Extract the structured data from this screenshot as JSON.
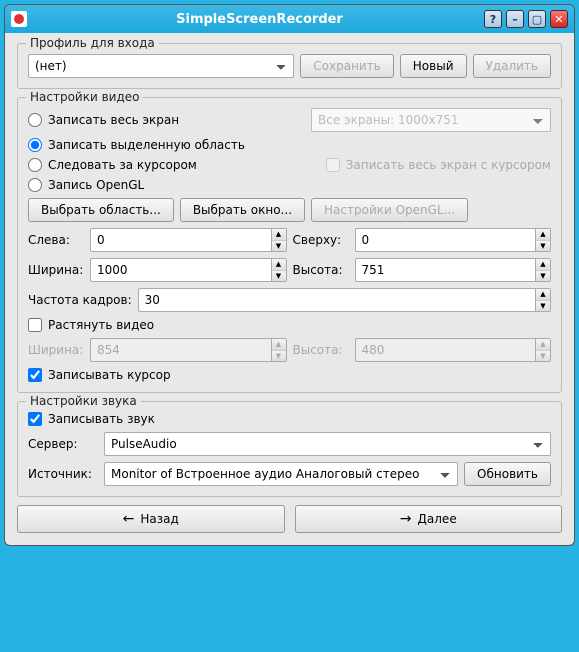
{
  "window": {
    "title": "SimpleScreenRecorder"
  },
  "profile": {
    "title": "Профиль для входа",
    "selected": "(нет)",
    "save": "Сохранить",
    "new": "Новый",
    "delete": "Удалить"
  },
  "video": {
    "title": "Настройки видео",
    "r_fullscreen": "Записать весь экран",
    "r_area": "Записать выделенную область",
    "r_cursor": "Следовать за курсором",
    "r_opengl": "Запись OpenGL",
    "screens": "Все экраны: 1000x751",
    "with_cursor": "Записать весь экран с курсором",
    "select_area": "Выбрать область...",
    "select_window": "Выбрать окно...",
    "opengl_settings": "Настройки OpenGL...",
    "left_lbl": "Слева:",
    "left": "0",
    "top_lbl": "Сверху:",
    "top": "0",
    "width_lbl": "Ширина:",
    "width": "1000",
    "height_lbl": "Высота:",
    "height": "751",
    "fps_lbl": "Частота кадров:",
    "fps": "30",
    "scale": "Растянуть видео",
    "swidth_lbl": "Ширина:",
    "swidth": "854",
    "sheight_lbl": "Высота:",
    "sheight": "480",
    "record_cursor": "Записывать курсор"
  },
  "audio": {
    "title": "Настройки звука",
    "record": "Записывать звук",
    "server_lbl": "Сервер:",
    "server": "PulseAudio",
    "source_lbl": "Источник:",
    "source": "Monitor of Встроенное аудио Аналоговый стерео",
    "refresh": "Обновить"
  },
  "nav": {
    "back": "Назад",
    "next": "Далее"
  }
}
